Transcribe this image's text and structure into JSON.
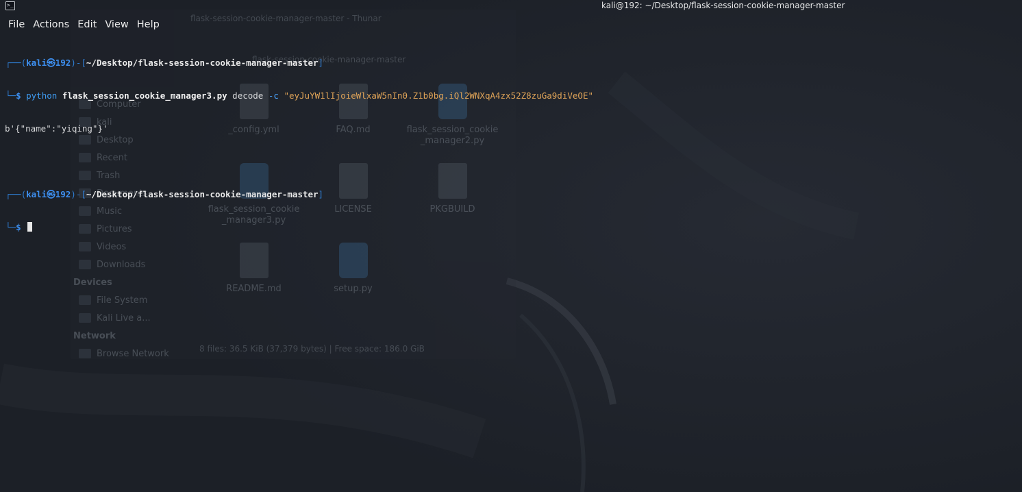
{
  "window": {
    "title": "kali@192: ~/Desktop/flask-session-cookie-manager-master",
    "app_icon": "terminal-icon"
  },
  "menu": {
    "items": [
      "File",
      "Actions",
      "Edit",
      "View",
      "Help"
    ]
  },
  "terminal": {
    "prompt1": {
      "frame_top": "┌──(",
      "user": "kali",
      "at": "㉿",
      "host": "192",
      "frame_mid": ")-[",
      "path": "~/Desktop/flask-session-cookie-manager-master",
      "frame_end": "]",
      "frame_bottom": "└─",
      "dollar": "$"
    },
    "command": {
      "program": "python",
      "script": "flask_session_cookie_manager3.py",
      "action": "decode",
      "flag": "-c",
      "value": "\"eyJuYW1lIjoieWlxaW5nIn0.Z1b0bg.iQl2WNXqA4zx52Z8zuGa9diVeOE\""
    },
    "output": "b'{\"name\":\"yiqing\"}'",
    "prompt2": {
      "frame_top": "┌──(",
      "user": "kali",
      "at": "㉿",
      "host": "192",
      "frame_mid": ")-[",
      "path": "~/Desktop/flask-session-cookie-manager-master",
      "frame_end": "]",
      "frame_bottom": "└─",
      "dollar": "$"
    }
  },
  "background_filemanager": {
    "title": "flask-session-cookie-manager-master - Thunar",
    "path": "flask-session-cookie-manager-master",
    "sidebar": [
      {
        "label": "Computer",
        "type": "heading"
      },
      {
        "label": "kali",
        "type": "item"
      },
      {
        "label": "Desktop",
        "type": "item"
      },
      {
        "label": "Recent",
        "type": "item"
      },
      {
        "label": "Trash",
        "type": "item"
      },
      {
        "label": "Documents",
        "type": "item"
      },
      {
        "label": "Music",
        "type": "item"
      },
      {
        "label": "Pictures",
        "type": "item"
      },
      {
        "label": "Videos",
        "type": "item"
      },
      {
        "label": "Downloads",
        "type": "item"
      },
      {
        "label": "Devices",
        "type": "heading"
      },
      {
        "label": "File System",
        "type": "item"
      },
      {
        "label": "Kali Live a...",
        "type": "item"
      },
      {
        "label": "Network",
        "type": "heading"
      },
      {
        "label": "Browse Network",
        "type": "item"
      }
    ],
    "files": [
      {
        "name": "_config.yml",
        "kind": "doc"
      },
      {
        "name": "FAQ.md",
        "kind": "doc"
      },
      {
        "name": "flask_session_cookie_manager2.py",
        "kind": "py"
      },
      {
        "name": "flask_session_cookie_manager3.py",
        "kind": "py"
      },
      {
        "name": "LICENSE",
        "kind": "doc"
      },
      {
        "name": "PKGBUILD",
        "kind": "doc"
      },
      {
        "name": "README.md",
        "kind": "doc"
      },
      {
        "name": "setup.py",
        "kind": "py"
      }
    ],
    "status": "8 files: 36.5 KiB (37,379 bytes) | Free space: 186.0 GiB"
  },
  "colors": {
    "background": "#1f232b",
    "prompt_blue": "#3d8ff0",
    "string_orange": "#e0a458",
    "text": "#d6d7d9"
  }
}
